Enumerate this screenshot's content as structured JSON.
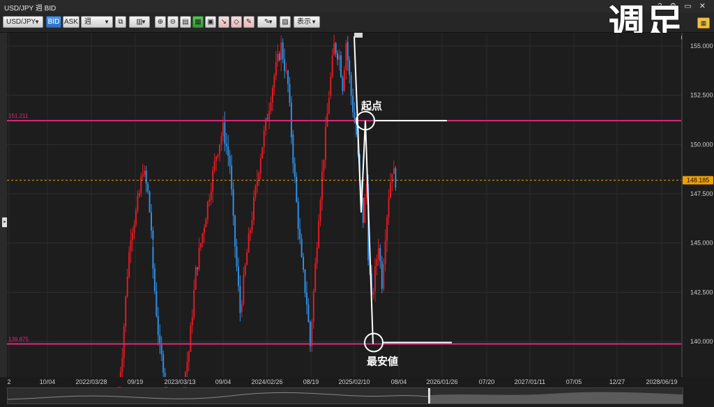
{
  "window": {
    "title": "USD/JPY 週 BID",
    "controls": [
      "?",
      "⚙",
      "▭",
      "✕"
    ]
  },
  "toolbar": {
    "symbol": "USD/JPY",
    "bid_label": "BID",
    "ask_label": "ASK",
    "period": "週",
    "display_label": "表示",
    "big_label": "週足"
  },
  "colors": {
    "bull": "#e31b23",
    "bear": "#2f8fe6",
    "hline": "#e0287a",
    "current": "#f0a000",
    "annotation": "#ffffff"
  },
  "chart_data": {
    "type": "candlestick",
    "ylim": [
      138.0,
      155.5
    ],
    "yticks": [
      "155.000",
      "152.500",
      "150.000",
      "147.500",
      "145.000",
      "142.500",
      "140.000"
    ],
    "xticks": [
      "2",
      "10/04",
      "2022/03/28",
      "09/19",
      "2023/03/13",
      "09/04",
      "2024/02/26",
      "08/19",
      "2025/02/10",
      "08/04",
      "2026/01/26",
      "07/20",
      "2027/01/11",
      "07/05",
      "12/27",
      "2028/06/19"
    ],
    "current_price": 148.185,
    "current_price_label": "148.185",
    "hlines": [
      {
        "value": 151.211,
        "label": "151.211"
      },
      {
        "value": 139.875,
        "label": "139.875"
      }
    ],
    "annotations": [
      {
        "text": "起点",
        "value": 151.211
      },
      {
        "text": "最安値",
        "value": 139.875
      }
    ],
    "series_segments": [
      {
        "start_week": 0,
        "weeks": 20,
        "open": 137.0,
        "waypoints": [
          [
            0,
            137.0
          ],
          [
            3,
            139.5
          ],
          [
            6,
            143.5
          ],
          [
            8,
            145.5
          ],
          [
            11,
            146.5
          ],
          [
            13,
            147.5
          ],
          [
            15,
            148.8
          ],
          [
            18,
            147.5
          ],
          [
            21,
            144.8
          ]
        ]
      },
      {
        "start_week": 20,
        "weeks": 10,
        "open": 144.8,
        "waypoints": [
          [
            0,
            144.8
          ],
          [
            3,
            141.5
          ],
          [
            5,
            139.5
          ],
          [
            7,
            138.8
          ],
          [
            9,
            137.5
          ]
        ]
      },
      {
        "start_week": 38,
        "weeks": 34,
        "open": 137.5,
        "waypoints": [
          [
            0,
            137.5
          ],
          [
            4,
            139.5
          ],
          [
            8,
            143.5
          ],
          [
            12,
            145.5
          ],
          [
            16,
            147.5
          ],
          [
            20,
            149.5
          ],
          [
            24,
            150.8
          ],
          [
            28,
            149.0
          ],
          [
            30,
            146.0
          ],
          [
            34,
            141.5
          ]
        ]
      },
      {
        "start_week": 72,
        "weeks": 30,
        "open": 141.5,
        "waypoints": [
          [
            0,
            141.5
          ],
          [
            4,
            144.5
          ],
          [
            8,
            147.0
          ],
          [
            12,
            149.5
          ],
          [
            16,
            151.5
          ],
          [
            20,
            153.5
          ],
          [
            24,
            155.0
          ],
          [
            28,
            153.0
          ],
          [
            30,
            150.5
          ]
        ]
      },
      {
        "start_week": 102,
        "weeks": 22,
        "open": 150.5,
        "waypoints": [
          [
            0,
            150.5
          ],
          [
            3,
            147.0
          ],
          [
            6,
            144.0
          ],
          [
            9,
            142.0
          ],
          [
            11,
            139.8
          ],
          [
            13,
            142.5
          ],
          [
            16,
            146.5
          ],
          [
            19,
            149.5
          ],
          [
            22,
            152.5
          ]
        ]
      },
      {
        "start_week": 124,
        "weeks": 10,
        "open": 152.5,
        "waypoints": [
          [
            0,
            152.5
          ],
          [
            3,
            155.0
          ],
          [
            6,
            154.5
          ],
          [
            8,
            153.0
          ],
          [
            10,
            155.2
          ]
        ]
      },
      {
        "start_week": 134,
        "weeks": 30,
        "open": 155.2,
        "waypoints": [
          [
            0,
            155.2
          ],
          [
            3,
            152.5
          ],
          [
            6,
            150.5
          ],
          [
            8,
            148.0
          ],
          [
            10,
            146.2
          ],
          [
            12,
            148.0
          ],
          [
            13,
            144.5
          ],
          [
            15,
            142.0
          ],
          [
            17,
            143.5
          ],
          [
            19,
            145.0
          ],
          [
            21,
            143.0
          ],
          [
            23,
            145.5
          ],
          [
            25,
            147.5
          ],
          [
            27,
            148.8
          ],
          [
            29,
            148.2
          ]
        ]
      }
    ]
  }
}
